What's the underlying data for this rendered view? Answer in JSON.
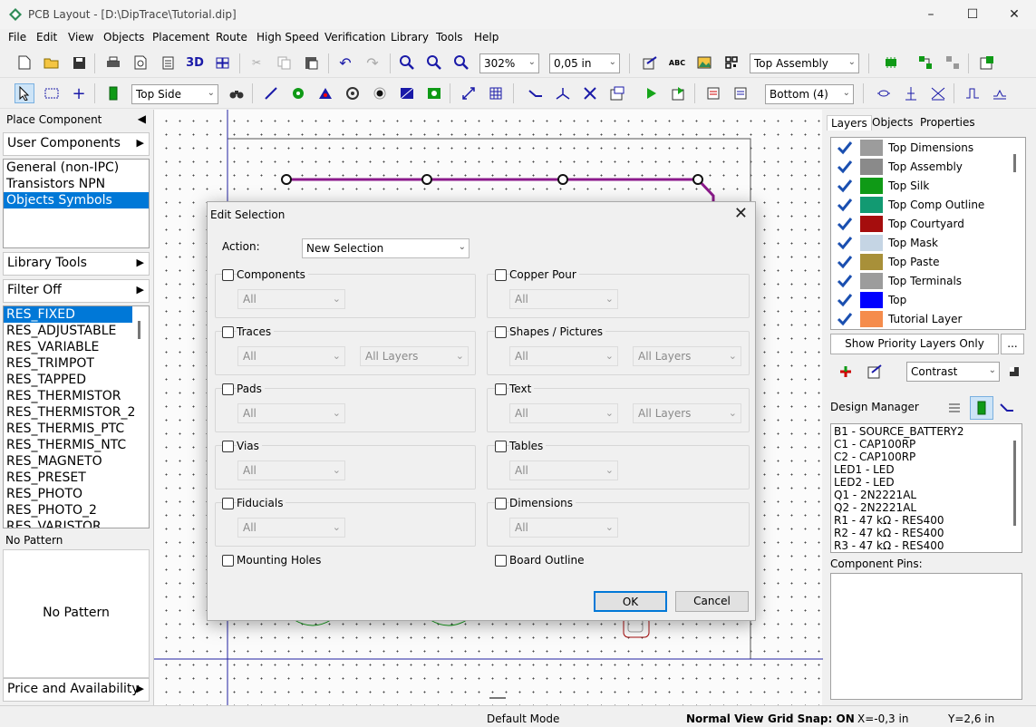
{
  "window": {
    "title": "PCB Layout - [D:\\DipTrace\\Tutorial.dip]",
    "minimize": "–",
    "maximize": "☐",
    "close": "✕"
  },
  "menu": [
    "File",
    "Edit",
    "View",
    "Objects",
    "Placement",
    "Route",
    "High Speed",
    "Verification",
    "Library",
    "Tools",
    "Help"
  ],
  "toolbar1": {
    "zoom_value": "302%",
    "grid_value": "0,05 in",
    "layer_view": "Top Assembly",
    "btn_3d": "3D",
    "abc": "ABC"
  },
  "toolbar2": {
    "side": "Top Side",
    "route_layer": "Bottom (4)"
  },
  "left_panel": {
    "place_component": "Place Component",
    "user_components": "User Components",
    "libraries": [
      "General (non-IPC)",
      "Transistors NPN",
      "Objects Symbols"
    ],
    "library_tools": "Library Tools",
    "filter": "Filter Off",
    "components": [
      "RES_FIXED",
      "RES_ADJUSTABLE",
      "RES_VARIABLE",
      "RES_TRIMPOT",
      "RES_TAPPED",
      "RES_THERMISTOR",
      "RES_THERMISTOR_2",
      "RES_THERMIS_PTC",
      "RES_THERMIS_NTC",
      "RES_MAGNETO",
      "RES_PRESET",
      "RES_PHOTO",
      "RES_PHOTO_2",
      "RES_VARISTOR"
    ],
    "pattern_label": "No Pattern",
    "pattern_preview": "No Pattern",
    "price": "Price and Availability"
  },
  "right_panel": {
    "tabs": [
      "Layers",
      "Objects",
      "Properties"
    ],
    "layers": [
      {
        "name": "Top Dimensions",
        "color": "#9c9c9c"
      },
      {
        "name": "Top Assembly",
        "color": "#8a8a8a"
      },
      {
        "name": "Top Silk",
        "color": "#0f9a16"
      },
      {
        "name": "Top Comp Outline",
        "color": "#129a72"
      },
      {
        "name": "Top Courtyard",
        "color": "#a50d0d"
      },
      {
        "name": "Top Mask",
        "color": "#c5d5e4"
      },
      {
        "name": "Top Paste",
        "color": "#a89039"
      },
      {
        "name": "Top Terminals",
        "color": "#9c9c9c"
      },
      {
        "name": "Top",
        "color": "#0000ff"
      },
      {
        "name": "Tutorial Layer",
        "color": "#f58c4c"
      }
    ],
    "priority_btn": "Show Priority Layers Only",
    "more_btn": "...",
    "contrast": "Contrast",
    "design_manager": "Design Manager",
    "dm_items": [
      "B1 - SOURCE_BATTERY2",
      "C1 - CAP100RP",
      "C2 - CAP100RP",
      "LED1 - LED",
      "LED2 - LED",
      "Q1 - 2N2221AL",
      "Q2 - 2N2221AL",
      "R1 - 47 kΩ - RES400",
      "R2 - 47 kΩ - RES400",
      "R3 - 47 kΩ - RES400"
    ],
    "component_pins": "Component Pins:"
  },
  "dialog": {
    "title": "Edit Selection",
    "action_label": "Action:",
    "action_value": "New Selection",
    "all": "All",
    "all_layers": "All Layers",
    "groups_left": [
      "Components",
      "Traces",
      "Pads",
      "Vias",
      "Fiducials",
      "Mounting Holes"
    ],
    "groups_right": [
      "Copper Pour",
      "Shapes / Pictures",
      "Text",
      "Tables",
      "Dimensions",
      "Board Outline"
    ],
    "ok": "OK",
    "cancel": "Cancel"
  },
  "status": {
    "mode": "Default Mode",
    "view": "Normal View",
    "snap": "Grid Snap: ON",
    "x": "X=-0,3 in",
    "y": "Y=2,6 in"
  },
  "colors": {
    "selection": "#0078d7",
    "trace": "#8b1a8b",
    "board_outline": "#2020a0"
  }
}
